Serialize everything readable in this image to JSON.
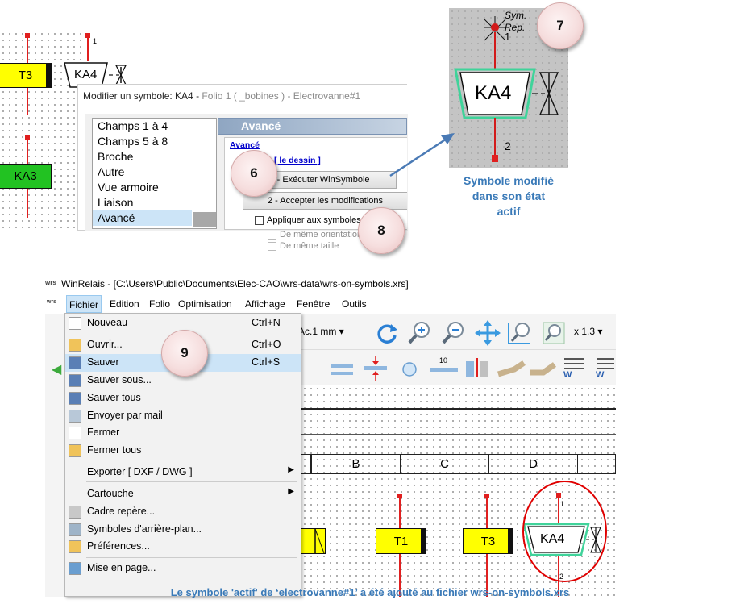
{
  "schematic_top": {
    "coil_t3": "T3",
    "coil_ka4": "KA4",
    "coil_ka3": "KA3",
    "terminal_1": "1"
  },
  "dialog": {
    "title_prefix": "Modifier un symbole: KA4 - ",
    "title_suffix": "Folio 1 ( _bobines ) - Electrovanne#1",
    "list_items": [
      "Champs 1 à 4",
      "Champs 5 à 8",
      "Broche",
      "Autre",
      "Vue armoire",
      "Liaison",
      "Avancé"
    ],
    "selected_item": "Avancé",
    "panel_title": "Avancé",
    "section_link": "Avancé",
    "sub_link": "[ le dessin ]",
    "btn_execute": "1 - Exécuter WinSymbole",
    "btn_accept": "2 - Accepter les modifications",
    "chk_apply": "Appliquer aux symboles id",
    "chk_orientation": "De même orientation",
    "chk_size": "De même taille"
  },
  "badges": {
    "b6": "6",
    "b7": "7",
    "b8": "8",
    "b9": "9"
  },
  "preview": {
    "sym_label_1": "Sym.",
    "sym_label_2": "Rep.",
    "terminal_top": "1",
    "coil": "KA4",
    "terminal_bottom": "2",
    "caption_line1": "Symbole modifié",
    "caption_line2": "dans son état",
    "caption_line3": "actif"
  },
  "winrelais": {
    "title": "WinRelais - [C:\\Users\\Public\\Documents\\Elec-CAO\\wrs-data\\wrs-on-symbols.xrs]",
    "menu": [
      "Fichier",
      "Edition",
      "Folio",
      "Optimisation",
      "Affichage",
      "Fenêtre",
      "Outils"
    ],
    "active_menu": "Fichier",
    "dropdown": [
      {
        "label": "Nouveau",
        "shortcut": "Ctrl+N"
      },
      {
        "label": "Ouvrir...",
        "shortcut": "Ctrl+O"
      },
      {
        "label": "Sauver",
        "shortcut": "Ctrl+S"
      },
      {
        "label": "Sauver sous...",
        "shortcut": ""
      },
      {
        "label": "Sauver tous",
        "shortcut": ""
      },
      {
        "label": "Envoyer par mail",
        "shortcut": ""
      },
      {
        "label": "Fermer",
        "shortcut": ""
      },
      {
        "label": "Fermer tous",
        "shortcut": ""
      },
      {
        "label": "Exporter [ DXF / DWG ]",
        "shortcut": ""
      },
      {
        "label": "Cartouche",
        "shortcut": ""
      },
      {
        "label": "Cadre repère...",
        "shortcut": ""
      },
      {
        "label": "Symboles d'arrière-plan...",
        "shortcut": ""
      },
      {
        "label": "Préférences...",
        "shortcut": ""
      },
      {
        "label": "Mise en page...",
        "shortcut": ""
      }
    ],
    "selected_dropdown": "Sauver",
    "toolbar_text": "Ac.1 mm",
    "zoom": "x 1.3",
    "columns": [
      "B",
      "C",
      "D"
    ],
    "coil_t1": "T1",
    "coil_t3": "T3",
    "coil_ka4": "KA4",
    "term_1": "1",
    "term_2": "2",
    "marker_10": "10"
  },
  "footer_caption": "Le symbole 'actif' de ‘electrovanne#1’ a été ajouté au fichier wrs-on-symbols.xrs",
  "colors": {
    "wire_red": "#e01f1f",
    "coil_yellow": "#ffff00",
    "coil_green": "#22c222",
    "caption_blue": "#3a7ab8",
    "highlight_blue": "#cce4f7",
    "annotation_red": "#e00000"
  }
}
